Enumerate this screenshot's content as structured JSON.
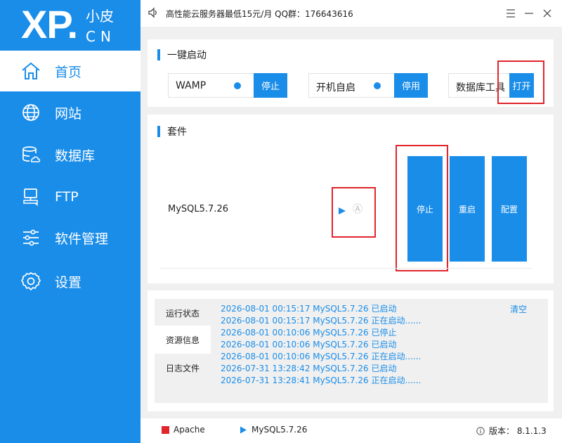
{
  "logo": {
    "main": "XP.",
    "sub_top": "小皮",
    "sub_bottom": "CN"
  },
  "sidebar": {
    "items": [
      {
        "label": "首页",
        "icon": "home-icon",
        "active": true
      },
      {
        "label": "网站",
        "icon": "globe-icon"
      },
      {
        "label": "数据库",
        "icon": "database-icon"
      },
      {
        "label": "FTP",
        "icon": "monitor-icon"
      },
      {
        "label": "软件管理",
        "icon": "sliders-icon"
      },
      {
        "label": "设置",
        "icon": "gear-icon"
      }
    ]
  },
  "topbar": {
    "notice": "高性能云服务器最低15元/月  QQ群：176643616"
  },
  "quick_start": {
    "title": "一键启动",
    "services": [
      {
        "label": "WAMP",
        "button": "停止"
      },
      {
        "label": "开机自启",
        "button": "停用"
      },
      {
        "label": "数据库工具",
        "button": "打开"
      }
    ]
  },
  "suite": {
    "title": "套件",
    "item_name": "MySQL5.7.26",
    "auto_glyph": "Ⓐ",
    "buttons": {
      "stop": "停止",
      "restart": "重启",
      "config": "配置"
    }
  },
  "logs": {
    "tabs": [
      "运行状态",
      "资源信息",
      "日志文件"
    ],
    "clear": "清空",
    "lines": [
      "2026-08-01 00:15:17 MySQL5.7.26 已启动",
      "2026-08-01 00:15:17 MySQL5.7.26 正在启动......",
      "2026-08-01 00:10:06 MySQL5.7.26 已停止",
      "2026-08-01 00:10:06 MySQL5.7.26 已启动",
      "2026-08-01 00:10:06 MySQL5.7.26 正在启动......",
      "2026-07-31 13:28:42 MySQL5.7.26 已启动",
      "2026-07-31 13:28:41 MySQL5.7.26 正在启动......"
    ]
  },
  "statusbar": {
    "apache": "Apache",
    "mysql": "MySQL5.7.26",
    "version": "版本： 8.1.1.3"
  },
  "colors": {
    "accent": "#1a8de9",
    "highlight": "#e0252c",
    "stopped": "#e0252c"
  }
}
